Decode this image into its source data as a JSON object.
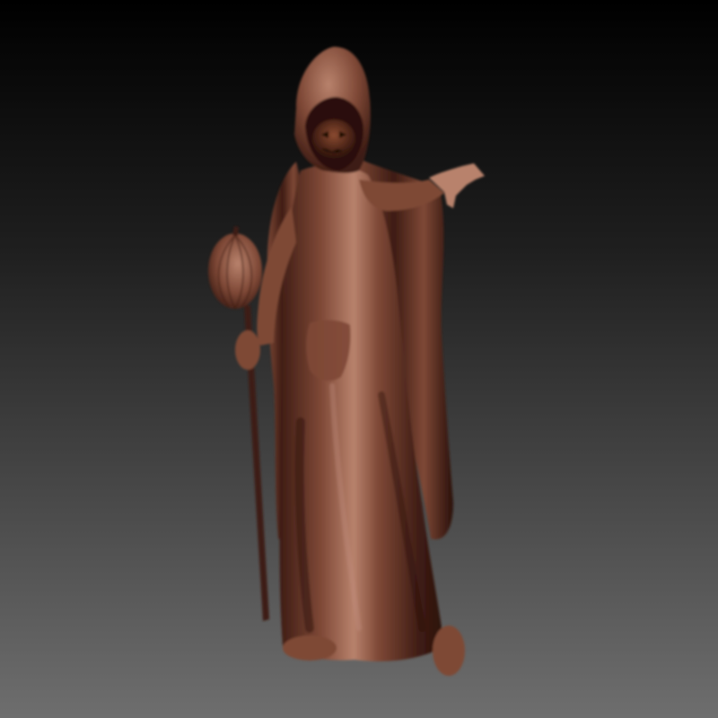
{
  "scene": {
    "background_top": "#000000",
    "background_bottom": "#6e6e6e",
    "clay_light": "#b8826c",
    "clay_mid": "#7e4836",
    "clay_dark": "#3e1c14",
    "clay_deep": "#2a100a"
  },
  "subject": {
    "parts": [
      "hood",
      "face",
      "cloak",
      "robe",
      "outstretched-hand",
      "staff",
      "pumpkin-orb",
      "left-boot",
      "right-boot",
      "belt-pouch"
    ]
  }
}
